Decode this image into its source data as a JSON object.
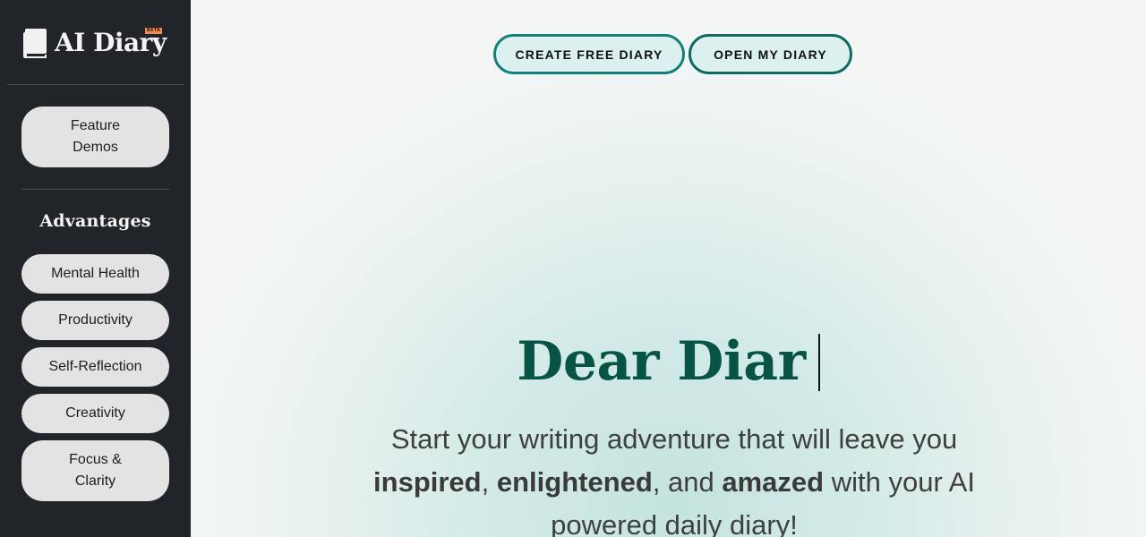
{
  "sidebar": {
    "logo": {
      "text": "AI Diary",
      "badge": "BETA",
      "icon": "book-icon"
    },
    "feature_demos_label": "Feature Demos",
    "advantages_heading": "Advantages",
    "advantages": [
      {
        "label": "Mental Health"
      },
      {
        "label": "Productivity"
      },
      {
        "label": "Self-Reflection"
      },
      {
        "label": "Creativity"
      },
      {
        "label": "Focus & Clarity"
      }
    ]
  },
  "header": {
    "create_label": "CREATE FREE DIARY",
    "open_label": "OPEN MY DIARY"
  },
  "hero": {
    "headline": "Dear Diar",
    "subtitle": {
      "part1": "Start your writing adventure that will leave you",
      "word1": "inspired",
      "sep1": ", ",
      "word2": "enlightened",
      "sep2": ", and ",
      "word3": "amazed",
      "part2": " with your AI powered daily diary!"
    }
  },
  "colors": {
    "sidebar_bg": "#212428",
    "accent": "#128178",
    "headline": "#075447",
    "badge": "#f08c5a"
  }
}
